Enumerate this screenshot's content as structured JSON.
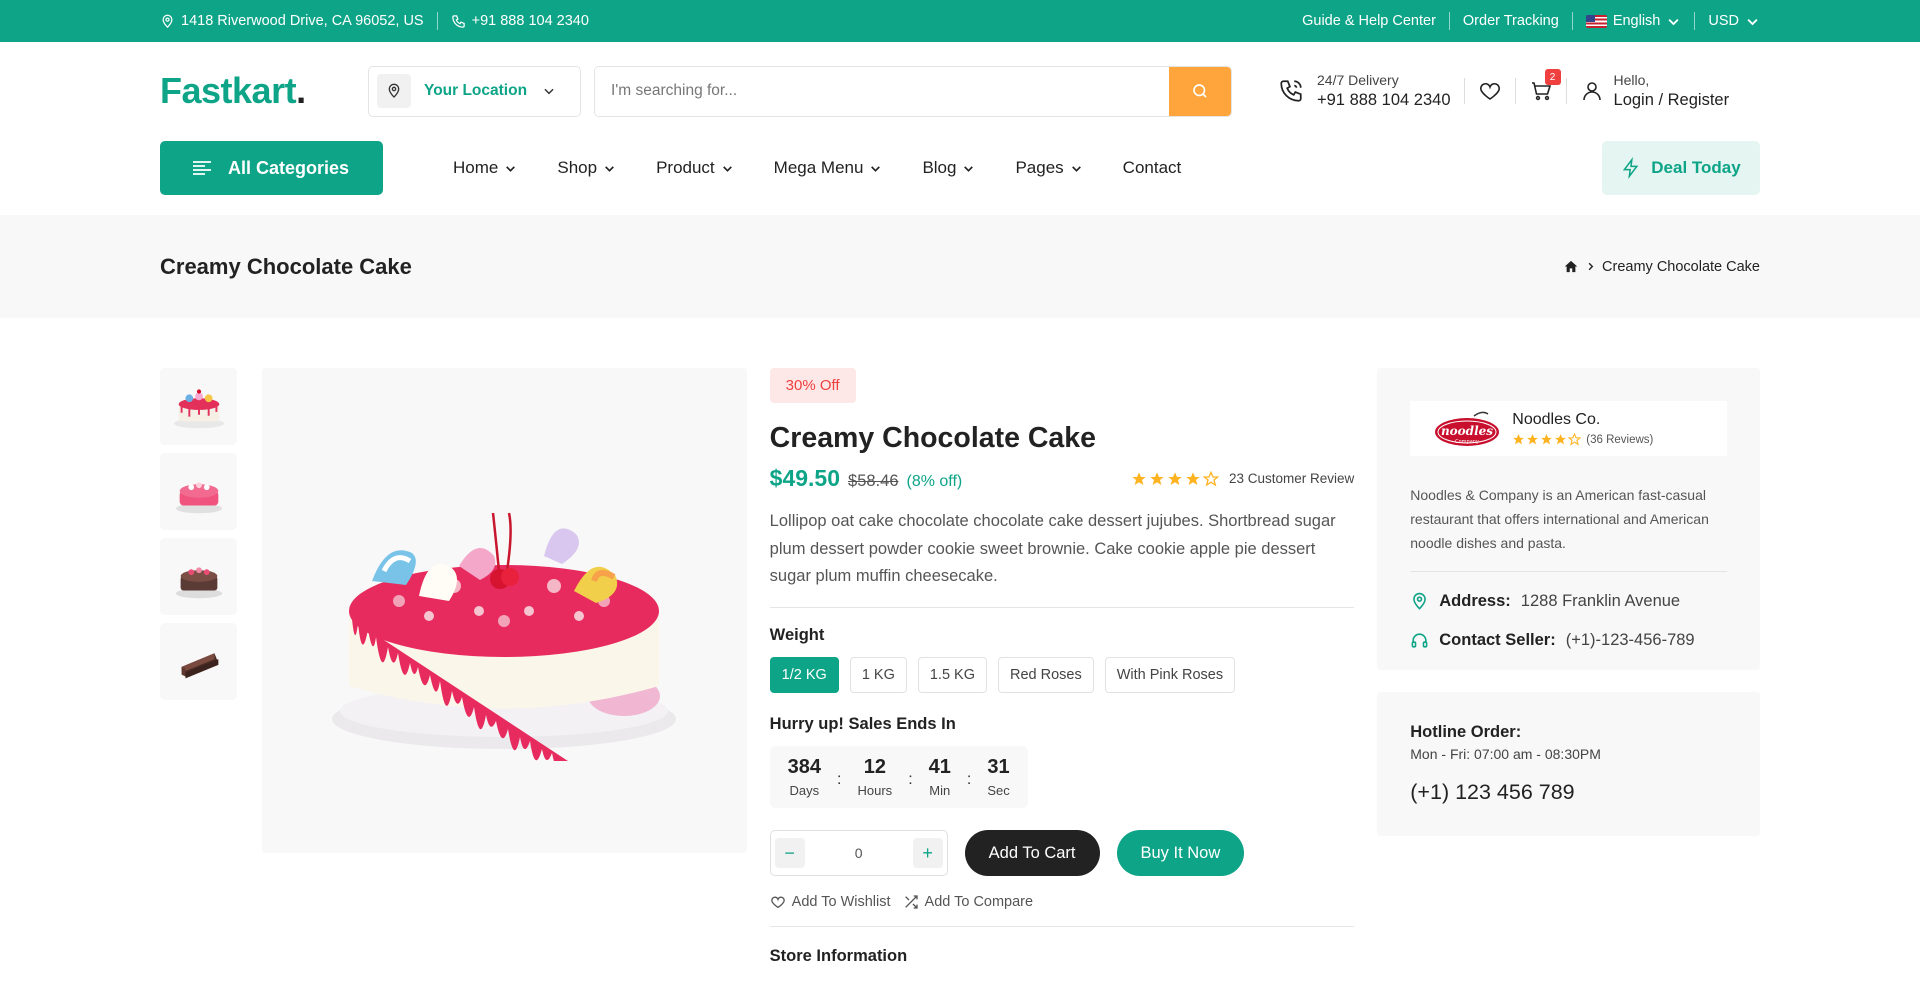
{
  "topbar": {
    "address": "1418 Riverwood Drive, CA 96052, US",
    "phone": "+91 888 104 2340",
    "help": "Guide & Help Center",
    "tracking": "Order Tracking",
    "language": "English",
    "currency": "USD"
  },
  "header": {
    "logo_main": "Fastkart",
    "logo_dot": ".",
    "location_label": "Your Location",
    "search_placeholder": "I'm searching for...",
    "delivery_label": "24/7 Delivery",
    "delivery_phone": "+91 888 104 2340",
    "cart_count": "2",
    "hello": "Hello,",
    "login": "Login / Register"
  },
  "nav": {
    "all_categories": "All Categories",
    "items": [
      "Home",
      "Shop",
      "Product",
      "Mega Menu",
      "Blog",
      "Pages",
      "Contact"
    ],
    "deal": "Deal Today"
  },
  "breadcrumb": {
    "title": "Creamy Chocolate Cake",
    "current": "Creamy Chocolate Cake"
  },
  "product": {
    "badge": "30% Off",
    "title": "Creamy Chocolate Cake",
    "price": "$49.50",
    "old_price": "$58.46",
    "discount": "(8% off)",
    "rating": 4,
    "reviews": "23 Customer Review",
    "description": "Lollipop oat cake chocolate chocolate cake dessert jujubes. Shortbread sugar plum dessert powder cookie sweet brownie. Cake cookie apple pie dessert sugar plum muffin cheesecake.",
    "weight_label": "Weight",
    "weights": [
      "1/2 KG",
      "1 KG",
      "1.5 KG",
      "Red Roses",
      "With Pink Roses"
    ],
    "sale_label": "Hurry up! Sales Ends In",
    "timer": [
      {
        "value": "384",
        "unit": "Days"
      },
      {
        "value": "12",
        "unit": "Hours"
      },
      {
        "value": "41",
        "unit": "Min"
      },
      {
        "value": "31",
        "unit": "Sec"
      }
    ],
    "quantity": "0",
    "add_to_cart": "Add To Cart",
    "buy_now": "Buy It Now",
    "wishlist": "Add To Wishlist",
    "compare": "Add To Compare",
    "store_info": "Store Information"
  },
  "seller": {
    "name": "Noodles Co.",
    "rating": 4,
    "reviews": "(36 Reviews)",
    "logo_text": "noodles",
    "logo_sub": "Company",
    "description": "Noodles & Company is an American fast-casual restaurant that offers international and American noodle dishes and pasta.",
    "address_label": "Address:",
    "address": "1288 Franklin Avenue",
    "contact_label": "Contact Seller:",
    "contact": "(+1)-123-456-789"
  },
  "hotline": {
    "title": "Hotline Order:",
    "hours": "Mon - Fri: 07:00 am - 08:30PM",
    "phone": "(+1) 123 456 789"
  },
  "colors": {
    "brand": "#0da487",
    "accent": "#ffa53b",
    "star": "#ffb321",
    "badge_red": "#ef3f3e"
  }
}
